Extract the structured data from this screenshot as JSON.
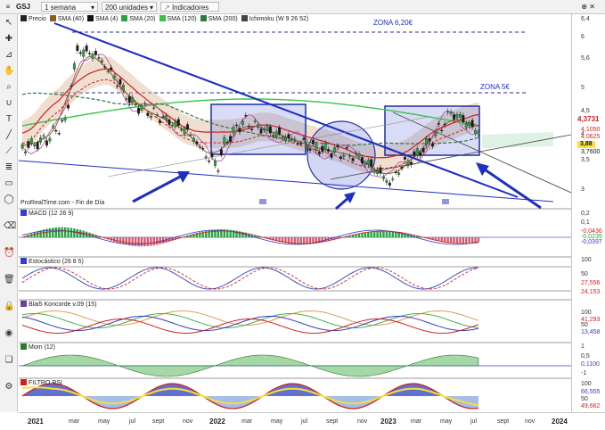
{
  "toolbar_top": {
    "symbol": "GSJ",
    "timeframe": "1 semana",
    "units": "200 unidades",
    "indicators": "Indicadores",
    "window_controls": "⊕ ✕"
  },
  "price_panel": {
    "legend": [
      {
        "label": "Precio",
        "color": "#222222"
      },
      {
        "label": "SMA (40)",
        "color": "#8b5a2b"
      },
      {
        "label": "SMA (4)",
        "color": "#111111"
      },
      {
        "label": "SMA (20)",
        "color": "#2aa43a"
      },
      {
        "label": "SMA (120)",
        "color": "#36c54a"
      },
      {
        "label": "SMA (200)",
        "color": "#2c7a3a"
      },
      {
        "label": "Ichimoku (W 9 26 52)",
        "color": "#444444"
      }
    ],
    "annotations": {
      "zona1": "ZONA 6,20€",
      "zona2": "ZONA 5€",
      "watermark": "ProRealTime.com - Fin de Día"
    },
    "y_ticks": [
      "6,4",
      "6",
      "5,6",
      "5",
      "4,5",
      "4",
      "3,5",
      "3"
    ],
    "tags": [
      {
        "text": "4,3731",
        "color": "#d21f1f",
        "bg": "#ffffff",
        "fg": "#d21f1f"
      },
      {
        "text": "4,1050",
        "color": "#d21f1f",
        "bg": "#ffffff",
        "fg": "#d21f1f"
      },
      {
        "text": "4,0625",
        "color": "#d21f1f",
        "bg": "#ffffff",
        "fg": "#d21f1f"
      },
      {
        "text": "3,88",
        "color": "#2aa43a",
        "bg": "#ffe23a",
        "fg": "#111111"
      },
      {
        "text": "3,7600",
        "color": "#111111",
        "bg": "#ffffff",
        "fg": "#111111"
      }
    ]
  },
  "macd_panel": {
    "title": "MACD (12 26 9)",
    "y_ticks": [
      "0,2",
      "0,1"
    ],
    "tags": [
      {
        "text": "-0,0436"
      },
      {
        "text": "-0,0239"
      },
      {
        "text": "-0,0397"
      }
    ]
  },
  "stoch_panel": {
    "title": "Estocástico (26 8 5)",
    "y_ticks": [
      "100",
      "50"
    ],
    "tags": [
      {
        "text": "27,556"
      },
      {
        "text": "24,153"
      }
    ]
  },
  "blai_panel": {
    "title": "Blai5 Koncorde v.09 (15)",
    "y_ticks": [
      "100",
      "50"
    ],
    "tags": [
      {
        "text": "41,293"
      },
      {
        "text": "13,458"
      }
    ]
  },
  "mom_panel": {
    "title": "Mom (12)",
    "y_ticks": [
      "1",
      "0,5",
      "-1"
    ],
    "tags": [
      {
        "text": "0,1100"
      }
    ]
  },
  "rsi_panel": {
    "title": "FILTRO RSI",
    "y_ticks": [
      "100",
      "50"
    ],
    "tags": [
      {
        "text": "66,555"
      },
      {
        "text": "49,662"
      }
    ]
  },
  "x_axis": {
    "months": [
      "mar",
      "may",
      "jul",
      "sept",
      "nov",
      "mar",
      "may",
      "jul",
      "sept",
      "nov",
      "mar",
      "may",
      "jul",
      "sept",
      "nov"
    ],
    "years": [
      "2021",
      "2022",
      "2023",
      "2024"
    ]
  },
  "tools": [
    "cursor",
    "crosshair",
    "ruler",
    "hand",
    "zoom",
    "magnet",
    "text",
    "line",
    "trendline",
    "fib",
    "rect",
    "shape",
    "eraser",
    "alert",
    "trash",
    "lock",
    "eye",
    "visibility"
  ]
}
